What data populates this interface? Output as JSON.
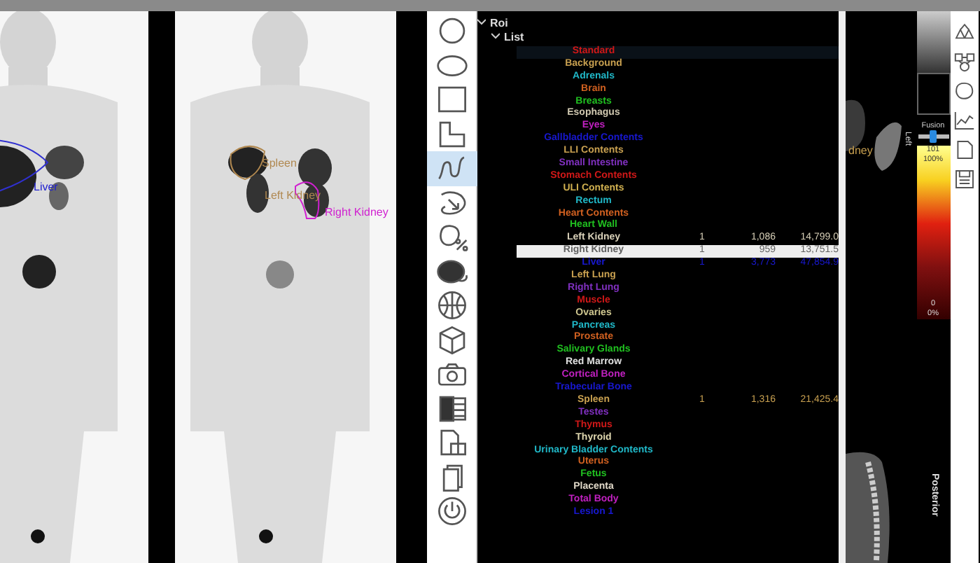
{
  "scans": [
    {
      "labels": [
        {
          "text": "Liver",
          "color": "#2020d0"
        }
      ]
    },
    {
      "labels": [
        {
          "text": "Spleen",
          "color": "#b08850"
        },
        {
          "text": "Left Kidney",
          "color": "#b08850"
        },
        {
          "text": "Right Kidney",
          "color": "#d020d0"
        }
      ]
    }
  ],
  "tools": [
    {
      "kind": "circle",
      "selected": false
    },
    {
      "kind": "ellipse",
      "selected": false
    },
    {
      "kind": "rectangle",
      "selected": false
    },
    {
      "kind": "l-shape",
      "selected": false
    },
    {
      "kind": "freehand",
      "selected": true
    },
    {
      "kind": "lasso",
      "selected": false
    },
    {
      "kind": "blob-percent",
      "selected": false
    },
    {
      "kind": "voi",
      "selected": false
    },
    {
      "kind": "globe",
      "selected": false
    },
    {
      "kind": "cube",
      "selected": false
    },
    {
      "kind": "camera",
      "selected": false
    },
    {
      "kind": "spreadsheet",
      "selected": false
    },
    {
      "kind": "document",
      "selected": false
    },
    {
      "kind": "pages",
      "selected": false
    },
    {
      "kind": "power",
      "selected": false
    }
  ],
  "tree": {
    "label": "Roi",
    "expanded": true,
    "child": {
      "label": "List",
      "expanded": true
    }
  },
  "rows": [
    {
      "name": "Standard",
      "color": "#d01818",
      "hovered": true,
      "selected": false
    },
    {
      "name": "Background",
      "color": "#c8a050",
      "hovered": false,
      "selected": false
    },
    {
      "name": "Adrenals",
      "color": "#20b8c8",
      "hovered": false,
      "selected": false
    },
    {
      "name": "Brain",
      "color": "#d06020",
      "hovered": false,
      "selected": false
    },
    {
      "name": "Breasts",
      "color": "#20c020",
      "hovered": false,
      "selected": false
    },
    {
      "name": "Esophagus",
      "color": "#d0c8b0",
      "hovered": false,
      "selected": false
    },
    {
      "name": "Eyes",
      "color": "#c020c0",
      "hovered": false,
      "selected": false
    },
    {
      "name": "Gallbladder Contents",
      "color": "#1818d0",
      "hovered": false,
      "selected": false
    },
    {
      "name": "LLI Contents",
      "color": "#c8a050",
      "hovered": false,
      "selected": false
    },
    {
      "name": "Small Intestine",
      "color": "#8030c0",
      "hovered": false,
      "selected": false
    },
    {
      "name": "Stomach Contents",
      "color": "#d01818",
      "hovered": false,
      "selected": false
    },
    {
      "name": "ULI Contents",
      "color": "#d0b050",
      "hovered": false,
      "selected": false
    },
    {
      "name": "Rectum",
      "color": "#20b8c8",
      "hovered": false,
      "selected": false
    },
    {
      "name": "Heart Contents",
      "color": "#d06020",
      "hovered": false,
      "selected": false
    },
    {
      "name": "Heart Wall",
      "color": "#20c020",
      "hovered": false,
      "selected": false
    },
    {
      "name": "Left Kidney",
      "color": "#d8d0b8",
      "hovered": false,
      "selected": false,
      "column_2": "1",
      "column_3": "1,086",
      "column_4": "14,799.0"
    },
    {
      "name": "Right Kidney",
      "color": "#606060",
      "hovered": false,
      "selected": true,
      "column_2": "1",
      "column_3": "959",
      "column_4": "13,751.5"
    },
    {
      "name": "Liver",
      "color": "#1818d0",
      "hovered": false,
      "selected": false,
      "column_2": "1",
      "column_3": "3,773",
      "column_4": "47,854.9"
    },
    {
      "name": "Left Lung",
      "color": "#c8a050",
      "hovered": false,
      "selected": false
    },
    {
      "name": "Right Lung",
      "color": "#8030c0",
      "hovered": false,
      "selected": false
    },
    {
      "name": "Muscle",
      "color": "#d01818",
      "hovered": false,
      "selected": false
    },
    {
      "name": "Ovaries",
      "color": "#d0c890",
      "hovered": false,
      "selected": false
    },
    {
      "name": "Pancreas",
      "color": "#20b8c8",
      "hovered": false,
      "selected": false
    },
    {
      "name": "Prostate",
      "color": "#d06020",
      "hovered": false,
      "selected": false
    },
    {
      "name": "Salivary Glands",
      "color": "#20c020",
      "hovered": false,
      "selected": false
    },
    {
      "name": "Red Marrow",
      "color": "#e0e0e0",
      "hovered": false,
      "selected": false
    },
    {
      "name": "Cortical Bone",
      "color": "#c020c0",
      "hovered": false,
      "selected": false
    },
    {
      "name": "Trabecular Bone",
      "color": "#1818d0",
      "hovered": false,
      "selected": false
    },
    {
      "name": "Spleen",
      "color": "#c8a050",
      "hovered": false,
      "selected": false,
      "column_2": "1",
      "column_3": "1,316",
      "column_4": "21,425.4"
    },
    {
      "name": "Testes",
      "color": "#8030c0",
      "hovered": false,
      "selected": false
    },
    {
      "name": "Thymus",
      "color": "#d01818",
      "hovered": false,
      "selected": false
    },
    {
      "name": "Thyroid",
      "color": "#e0d8b0",
      "hovered": false,
      "selected": false
    },
    {
      "name": "Urinary Bladder Contents",
      "color": "#20b8c8",
      "hovered": false,
      "selected": false
    },
    {
      "name": "Uterus",
      "color": "#d06020",
      "hovered": false,
      "selected": false
    },
    {
      "name": "Fetus",
      "color": "#20c020",
      "hovered": false,
      "selected": false
    },
    {
      "name": "Placenta",
      "color": "#e0d8c8",
      "hovered": false,
      "selected": false
    },
    {
      "name": "Total Body",
      "color": "#c020c0",
      "hovered": false,
      "selected": false
    },
    {
      "name": "Lesion 1",
      "color": "#1818d0",
      "hovered": false,
      "selected": false
    }
  ],
  "sagittal": {
    "label": "dney",
    "orientation": "Posterior"
  },
  "fusion": {
    "label": "Fusion",
    "side": "Left",
    "level": 0.5
  },
  "colorbar": {
    "max": "101",
    "max_percent": "100%",
    "min": "0",
    "min_percent": "0%"
  },
  "right_tools": [
    {
      "kind": "shapes"
    },
    {
      "kind": "nodes"
    },
    {
      "kind": "blob"
    },
    {
      "kind": "chart"
    },
    {
      "kind": "page"
    },
    {
      "kind": "save"
    }
  ]
}
